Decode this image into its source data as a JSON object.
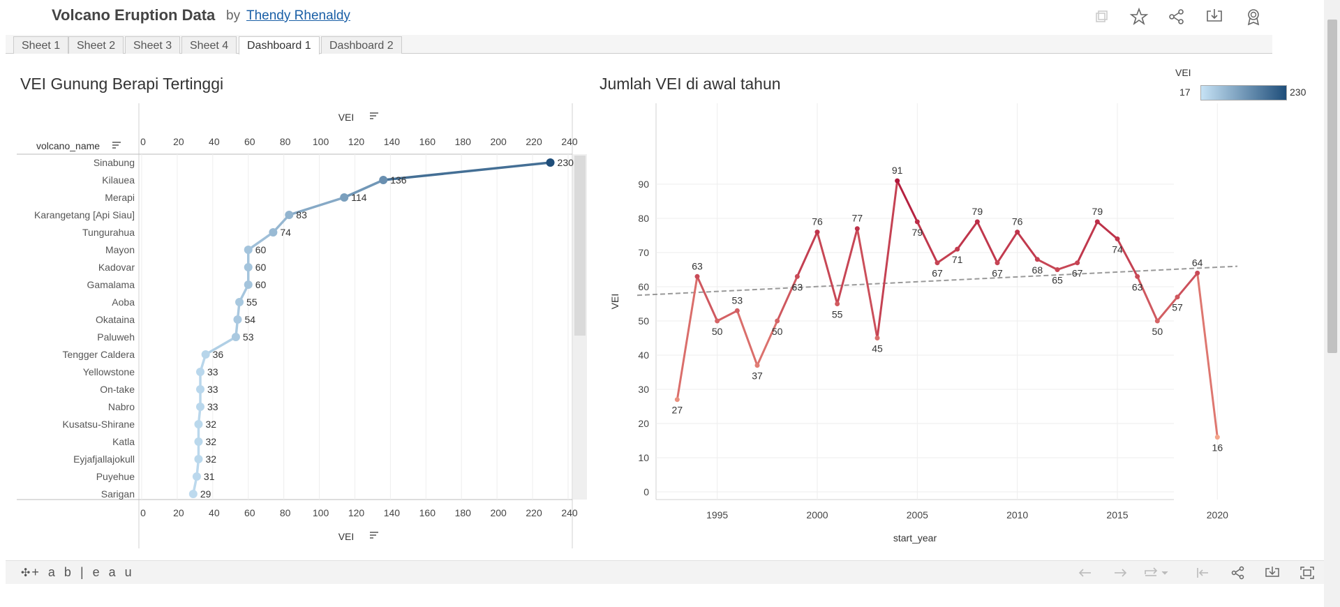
{
  "header": {
    "title": "Volcano Eruption Data",
    "by": "by",
    "author": "Thendy Rhenaldy",
    "icons": [
      "copy-icon",
      "star-icon",
      "share-icon",
      "download-icon",
      "badge-icon"
    ]
  },
  "tabs": [
    {
      "label": "Sheet 1",
      "active": false
    },
    {
      "label": "Sheet 2",
      "active": false
    },
    {
      "label": "Sheet 3",
      "active": false
    },
    {
      "label": "Sheet 4",
      "active": false
    },
    {
      "label": "Dashboard 1",
      "active": true
    },
    {
      "label": "Dashboard 2",
      "active": false
    }
  ],
  "legend": {
    "title": "VEI",
    "min": "17",
    "max": "230",
    "color_low": "#c6e2f5",
    "color_high": "#1f4e7a"
  },
  "footer": {
    "logo": "+ a b | e a u",
    "icons": [
      "undo-icon",
      "redo-icon",
      "revert-icon",
      "reset-icon",
      "share-icon",
      "download-icon",
      "fullscreen-icon"
    ]
  },
  "chart_data": [
    {
      "type": "line",
      "title": "VEI Gunung Berapi Tertinggi",
      "orientation": "horizontal",
      "row_header": "volcano_name",
      "xlabel": "VEI",
      "xlim": [
        0,
        240
      ],
      "xticks": [
        0,
        20,
        40,
        60,
        80,
        100,
        120,
        140,
        160,
        180,
        200,
        220,
        240
      ],
      "categories": [
        "Sinabung",
        "Kilauea",
        "Merapi",
        "Karangetang [Api Siau]",
        "Tungurahua",
        "Mayon",
        "Kadovar",
        "Gamalama",
        "Aoba",
        "Okataina",
        "Paluweh",
        "Tengger Caldera",
        "Yellowstone",
        "On-take",
        "Nabro",
        "Kusatsu-Shirane",
        "Katla",
        "Eyjafjallajokull",
        "Puyehue",
        "Sarigan"
      ],
      "values": [
        230,
        136,
        114,
        83,
        74,
        60,
        60,
        60,
        55,
        54,
        53,
        36,
        33,
        33,
        33,
        32,
        32,
        32,
        31,
        29
      ],
      "color_scale": [
        "#c6e2f5",
        "#1f4e7a"
      ]
    },
    {
      "type": "line",
      "title": "Jumlah VEI di awal tahun",
      "xlabel": "start_year",
      "ylabel": "VEI",
      "xlim": [
        1991,
        2021
      ],
      "ylim": [
        0,
        95
      ],
      "xticks": [
        1995,
        2000,
        2005,
        2010,
        2015,
        2020
      ],
      "yticks": [
        0,
        10,
        20,
        30,
        40,
        50,
        60,
        70,
        80,
        90
      ],
      "x": [
        1993,
        1994,
        1995,
        1996,
        1997,
        1998,
        1999,
        2000,
        2001,
        2002,
        2003,
        2004,
        2005,
        2006,
        2007,
        2008,
        2009,
        2010,
        2011,
        2012,
        2013,
        2014,
        2015,
        2016,
        2017,
        2018,
        2019,
        2020
      ],
      "y": [
        27,
        63,
        50,
        53,
        37,
        50,
        63,
        76,
        55,
        77,
        45,
        91,
        79,
        67,
        71,
        79,
        67,
        76,
        68,
        65,
        67,
        79,
        74,
        63,
        50,
        57,
        64,
        16
      ],
      "trend_line": {
        "x": [
          1991,
          2021
        ],
        "y": [
          57.5,
          66
        ],
        "style": "dashed"
      },
      "color_scale": [
        "#f4a58a",
        "#b0163a"
      ]
    }
  ]
}
